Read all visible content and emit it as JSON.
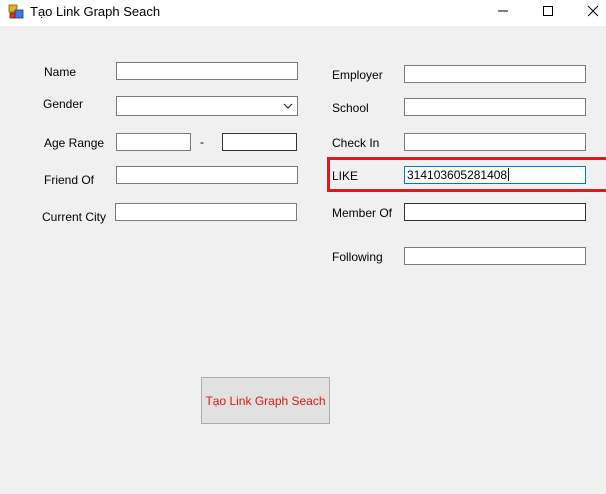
{
  "window": {
    "title": "Tạo Link Graph Seach",
    "app_icon": "winforms-app-icon",
    "controls": [
      "minimize-icon",
      "maximize-icon",
      "close-icon"
    ]
  },
  "form": {
    "left": {
      "name_label": "Name",
      "name_value": "",
      "gender_label": "Gender",
      "gender_value": "",
      "age_range_label": "Age Range",
      "age_from_value": "",
      "age_separator": "-",
      "age_to_value": "",
      "friend_of_label": "Friend Of",
      "friend_of_value": "",
      "current_city_label": "Current City",
      "current_city_value": ""
    },
    "right": {
      "employer_label": "Employer",
      "employer_value": "",
      "school_label": "School",
      "school_value": "",
      "check_in_label": "Check In",
      "check_in_value": "",
      "like_label": "LIKE",
      "like_value": "314103605281408",
      "member_of_label": "Member Of",
      "member_of_value": "",
      "following_label": "Following",
      "following_value": ""
    },
    "submit_label": "Tạo Link Graph Seach"
  },
  "colors": {
    "highlight": "#d11f1f",
    "button_text": "#e11414",
    "focus_border": "#0078d7",
    "background": "#f0f0f0"
  }
}
